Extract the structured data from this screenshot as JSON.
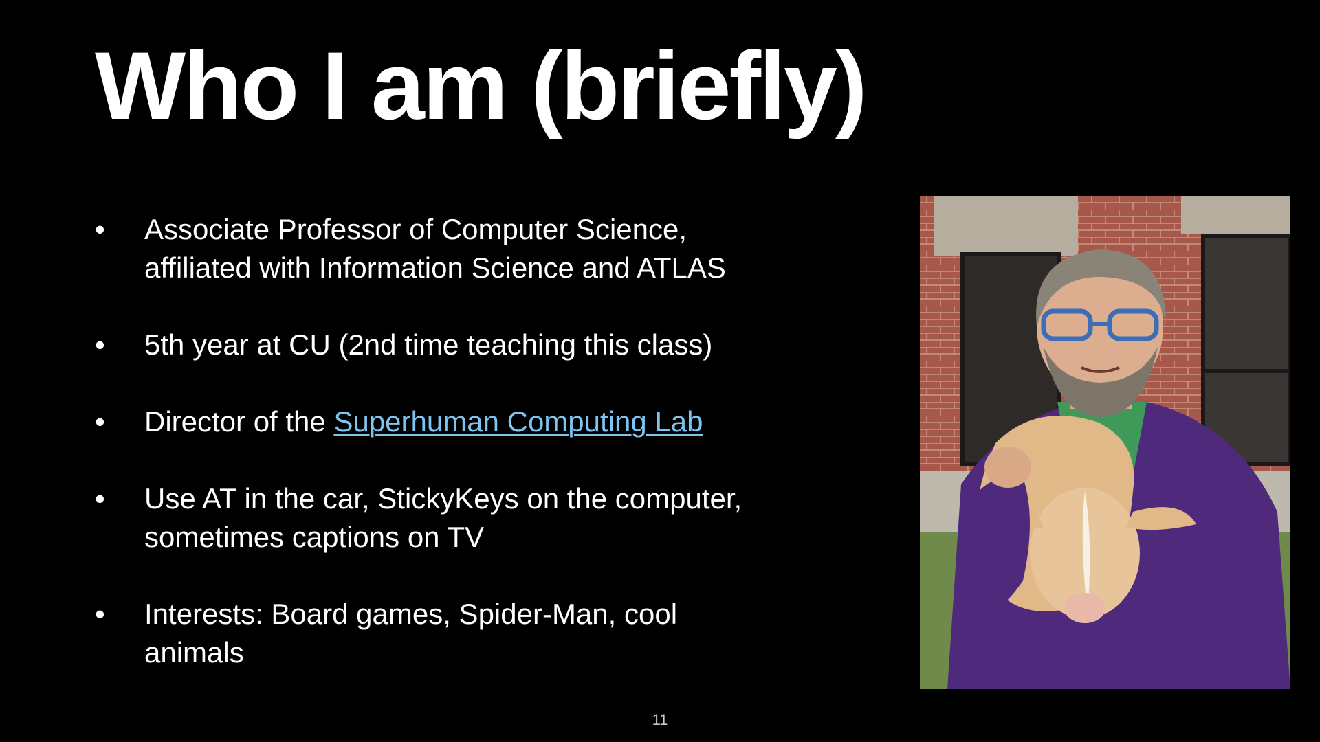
{
  "slide": {
    "title": "Who I am (briefly)",
    "bullet_symbol": "•",
    "bullets": [
      {
        "line1": "Associate Professor of Computer Science,",
        "line2": "affiliated with Information Science and ATLAS"
      },
      {
        "line1": "5th year at CU (2nd time teaching this class)"
      },
      {
        "prefix": "Director of the ",
        "link_text": "Superhuman Computing Lab"
      },
      {
        "line1": "Use AT in the car, StickyKeys on the computer,",
        "line2": "sometimes captions on TV"
      },
      {
        "line1": "Interests: Board games, Spider-Man, cool",
        "line2": "animals"
      }
    ],
    "slide_number": "11"
  },
  "colors": {
    "background": "#000000",
    "text": "#ffffff",
    "link": "#7fc4ef"
  }
}
